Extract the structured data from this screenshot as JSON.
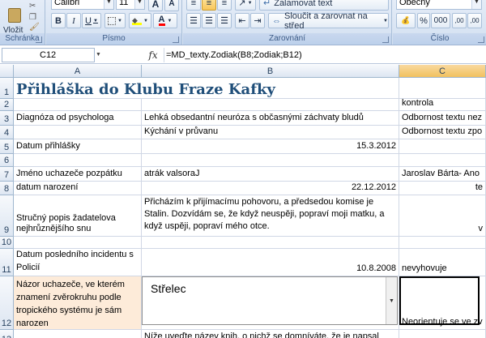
{
  "ribbon": {
    "font_name": "Calibri",
    "font_size": "11",
    "bold": "B",
    "italic": "I",
    "underline": "U",
    "grow_font": "A",
    "shrink_font": "A",
    "font_color_letter": "A",
    "paste_label": "Vložit",
    "clipboard_label": "Schránka",
    "font_group_label": "Písmo",
    "alignment_group_label": "Zarovnání",
    "number_group_label": "Číslo",
    "wrap_text": "Zalamovat text",
    "merge_center": "Sloučit a zarovnat na střed",
    "number_format": "Obecný",
    "percent": "%",
    "thousands": "000",
    "inc_decimal": ",00",
    "dec_decimal": ",00",
    "accent_color": "#1f4e79"
  },
  "formula_bar": {
    "cell_ref": "C12",
    "fx": "fx",
    "formula": "=MD_texty.Zodiak(B8;Zodiak;B12)"
  },
  "columns": [
    "A",
    "B",
    "C"
  ],
  "rows": [
    {
      "num": "1",
      "a": "Přihláška do Klubu Fraze Kafky",
      "b": "",
      "c": ""
    },
    {
      "num": "2",
      "a": "",
      "b": "",
      "c": "kontrola"
    },
    {
      "num": "3",
      "a": "Diagnóza od psychologa",
      "b": "Lehká obsedantní neuróza s občasnými záchvaty bludů",
      "c": "Odbornost textu nez"
    },
    {
      "num": "4",
      "a": "",
      "b": "Kýchání v průvanu",
      "c": "Odbornost textu zpo"
    },
    {
      "num": "5",
      "a": "Datum přihlášky",
      "b": "15.3.2012",
      "c": ""
    },
    {
      "num": "6",
      "a": "",
      "b": "",
      "c": ""
    },
    {
      "num": "7",
      "a": "Jméno uchazeče pozpátku",
      "b": "atrák valsorаJ",
      "c": "Jaroslav Bárta- Ano"
    },
    {
      "num": "8",
      "a": "datum narození",
      "b": "22.12.2012",
      "c": "te"
    },
    {
      "num": "9",
      "a": "Stručný popis žadatelova nejhrůznějšího snu",
      "b": "Přicházím k přijímacímu pohovoru, a předsedou komise je Stalin. Dozvídám se, že když neuspěji, popraví moji matku, a když uspěji, popraví mého otce.",
      "c": "v"
    },
    {
      "num": "10",
      "a": "",
      "b": "",
      "c": ""
    },
    {
      "num": "11",
      "a": "Datum posledního incidentu s Policií",
      "b": "10.8.2008",
      "c": "nevyhovuje"
    },
    {
      "num": "12",
      "a": "Názor uchazeče, ve kterém znamení zvěrokruhu podle tropického systému je sám narozen",
      "b": "",
      "c": "Neorientuje se ve zv"
    },
    {
      "num": "13",
      "a": "",
      "b": "Níže uveďte název knih, o nichž se domníváte, že je napsal",
      "c": ""
    }
  ],
  "dropdown_value": "Střelec"
}
